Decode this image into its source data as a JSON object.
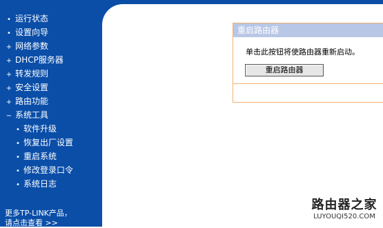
{
  "sidebar": {
    "items": [
      {
        "marker": "•",
        "label": "运行状态"
      },
      {
        "marker": "•",
        "label": "设置向导"
      },
      {
        "marker": "+",
        "label": "网络参数"
      },
      {
        "marker": "+",
        "label": "DHCP服务器"
      },
      {
        "marker": "+",
        "label": "转发规则"
      },
      {
        "marker": "+",
        "label": "安全设置"
      },
      {
        "marker": "+",
        "label": "路由功能"
      },
      {
        "marker": "−",
        "label": "系统工具"
      }
    ],
    "sub_items": [
      {
        "marker": "•",
        "label": "软件升级"
      },
      {
        "marker": "•",
        "label": "恢复出厂设置"
      },
      {
        "marker": "•",
        "label": "重启系统"
      },
      {
        "marker": "•",
        "label": "修改登录口令"
      },
      {
        "marker": "•",
        "label": "系统日志"
      }
    ],
    "more_line1": "更多TP-LINK产品，",
    "more_line2": "请点击查看 >>"
  },
  "panel": {
    "title": "重启路由器",
    "message": "单击此按钮将使路由器重新启动。",
    "button_label": "重启路由器"
  },
  "watermark": {
    "title": "路由器之家",
    "url": "LUYOUQI520.COM"
  },
  "colors": {
    "sidebar_bg": "#0a4ea8",
    "panel_header": "#b9c7e6",
    "panel_border": "#f0b070"
  }
}
